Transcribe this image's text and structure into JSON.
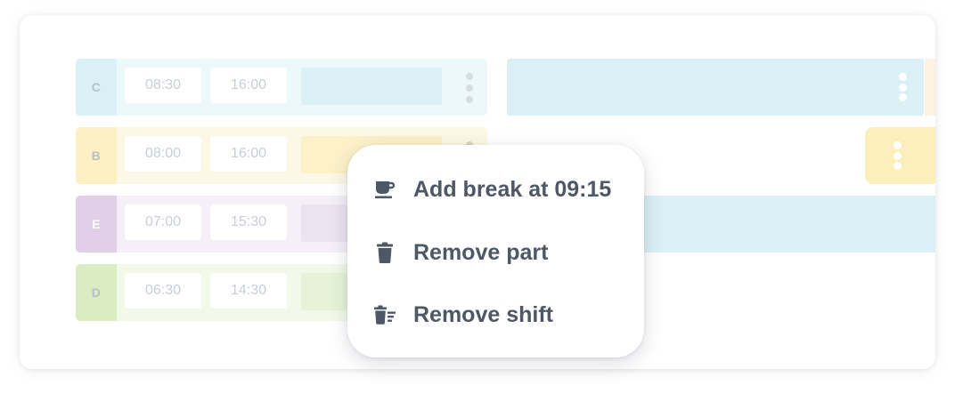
{
  "colors": {
    "row_c_tint": "#edf8fb",
    "row_c_accent": "#d9f0f5",
    "row_b_tint": "#fdf8e6",
    "row_b_accent": "#fdf0c2",
    "row_e_tint": "#f5f0f8",
    "row_e_accent": "#e1cfe7",
    "row_d_tint": "#f2f9e9",
    "row_d_accent": "#dcecc2",
    "timeline_blue": "#daf0f5",
    "timeline_yellow": "#fdefbc",
    "menu_text": "#4e5766"
  },
  "shifts": [
    {
      "label": "C",
      "start": "08:30",
      "end": "16:00"
    },
    {
      "label": "B",
      "start": "08:00",
      "end": "16:00"
    },
    {
      "label": "E",
      "start": "07:00",
      "end": "15:30"
    },
    {
      "label": "D",
      "start": "06:30",
      "end": "14:30"
    }
  ],
  "context_menu": {
    "items": [
      {
        "label": "Add break at 09:15",
        "icon": "coffee-cup-icon"
      },
      {
        "label": "Remove part",
        "icon": "trash-icon"
      },
      {
        "label": "Remove shift",
        "icon": "trash-list-icon"
      }
    ]
  }
}
